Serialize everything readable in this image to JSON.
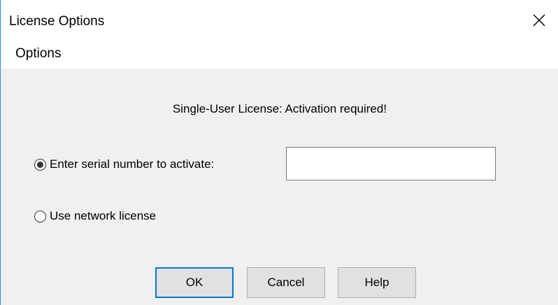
{
  "window": {
    "title": "License Options"
  },
  "menu": {
    "items": [
      "Options"
    ]
  },
  "status": {
    "text": "Single-User License: Activation required!"
  },
  "options": {
    "serial": {
      "label": "Enter serial number to activate:",
      "selected": true,
      "value": "",
      "placeholder": ""
    },
    "network": {
      "label": "Use network license",
      "selected": false
    }
  },
  "buttons": {
    "ok": "OK",
    "cancel": "Cancel",
    "help": "Help"
  },
  "icons": {
    "close": "close-icon"
  },
  "colors": {
    "window_border": "#1e90ff",
    "default_button_border": "#0078d7",
    "dialog_background": "#f0f0f0"
  }
}
